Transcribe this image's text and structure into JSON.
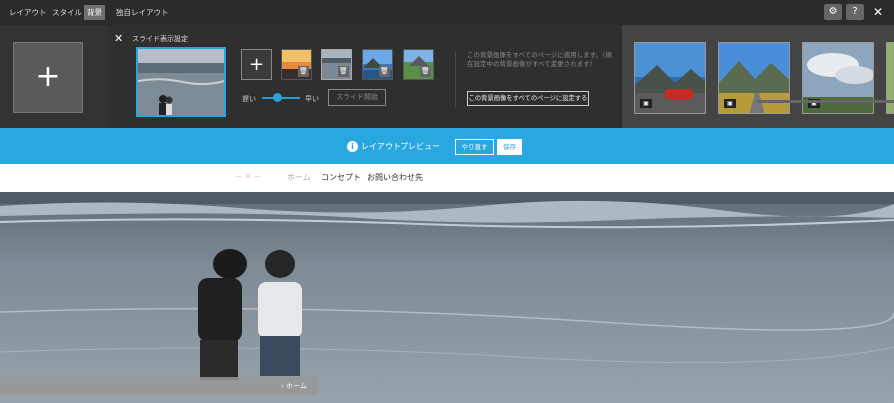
{
  "tabs": [
    "レイアウト",
    "スタイル",
    "背景",
    "独自レイアウト"
  ],
  "active_tab": "背景",
  "top_right": {
    "gear": "⚙",
    "help": "?",
    "close": "✕"
  },
  "slide": {
    "close": "✕",
    "title": "スライド表示設定",
    "add": "+",
    "slow": "遅い",
    "fast": "早い",
    "start": "スライド開始",
    "info": "この背景画像をすべてのページに適用します。（現在設定中の背景画像がすべて変更されます）",
    "apply_all": "この背景画像をすべてのページに設定する",
    "trash": "🗑",
    "speed_fraction": 0.4
  },
  "big_add": "+",
  "gallery_icon": "▣",
  "bluebar": {
    "layout": "レイアウト",
    "preview": "プレビュー",
    "undo": "やり直す",
    "save": "保存",
    "info": "i"
  },
  "nav": {
    "logo": "~ ✕ ~",
    "home": "ホーム",
    "concept": "コンセプト",
    "contact": "お問い合わせ先"
  },
  "breadcrumb": "› ホーム",
  "colors": {
    "accent": "#29a8df",
    "panel": "#3c3c3c",
    "topbar": "#2b2b2b"
  }
}
